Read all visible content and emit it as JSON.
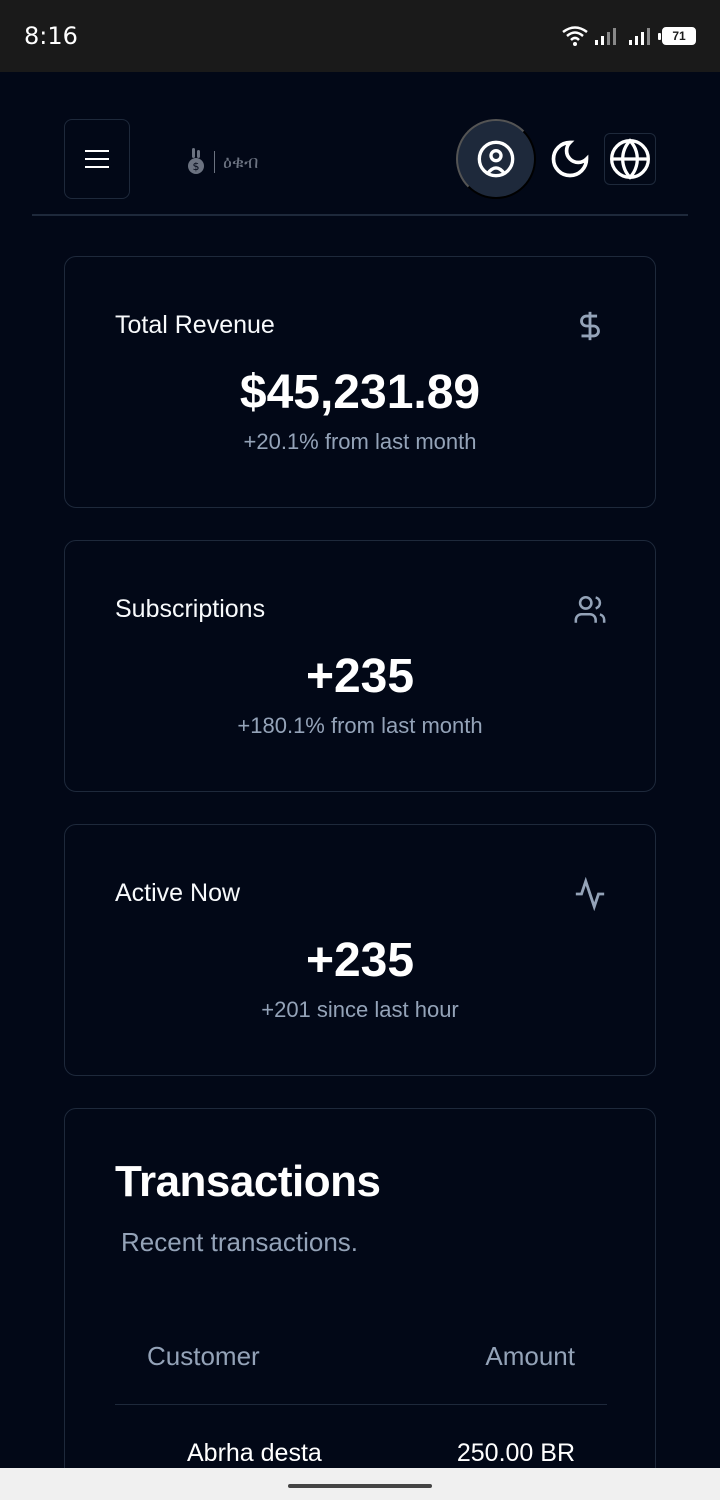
{
  "status_bar": {
    "time": "8:16",
    "battery": "71"
  },
  "header": {
    "logo_text": "ዕቁብ"
  },
  "icons": {
    "menu": "menu-icon",
    "user": "user-circle-icon",
    "theme": "moon-icon",
    "language": "globe-icon",
    "revenue": "dollar-icon",
    "subscriptions": "users-icon",
    "active": "activity-icon"
  },
  "colors": {
    "background": "#020817",
    "card_border": "#1e293b",
    "muted": "#94a3b8"
  },
  "stats": [
    {
      "title": "Total Revenue",
      "value": "$45,231.89",
      "sub": "+20.1% from last month"
    },
    {
      "title": "Subscriptions",
      "value": "+235",
      "sub": "+180.1% from last month"
    },
    {
      "title": "Active Now",
      "value": "+235",
      "sub": "+201 since last hour"
    }
  ],
  "transactions": {
    "title": "Transactions",
    "description": "Recent transactions.",
    "columns": {
      "customer": "Customer",
      "amount": "Amount"
    },
    "rows": [
      {
        "customer": "Abrha desta",
        "amount": "250.00 BR"
      }
    ]
  }
}
